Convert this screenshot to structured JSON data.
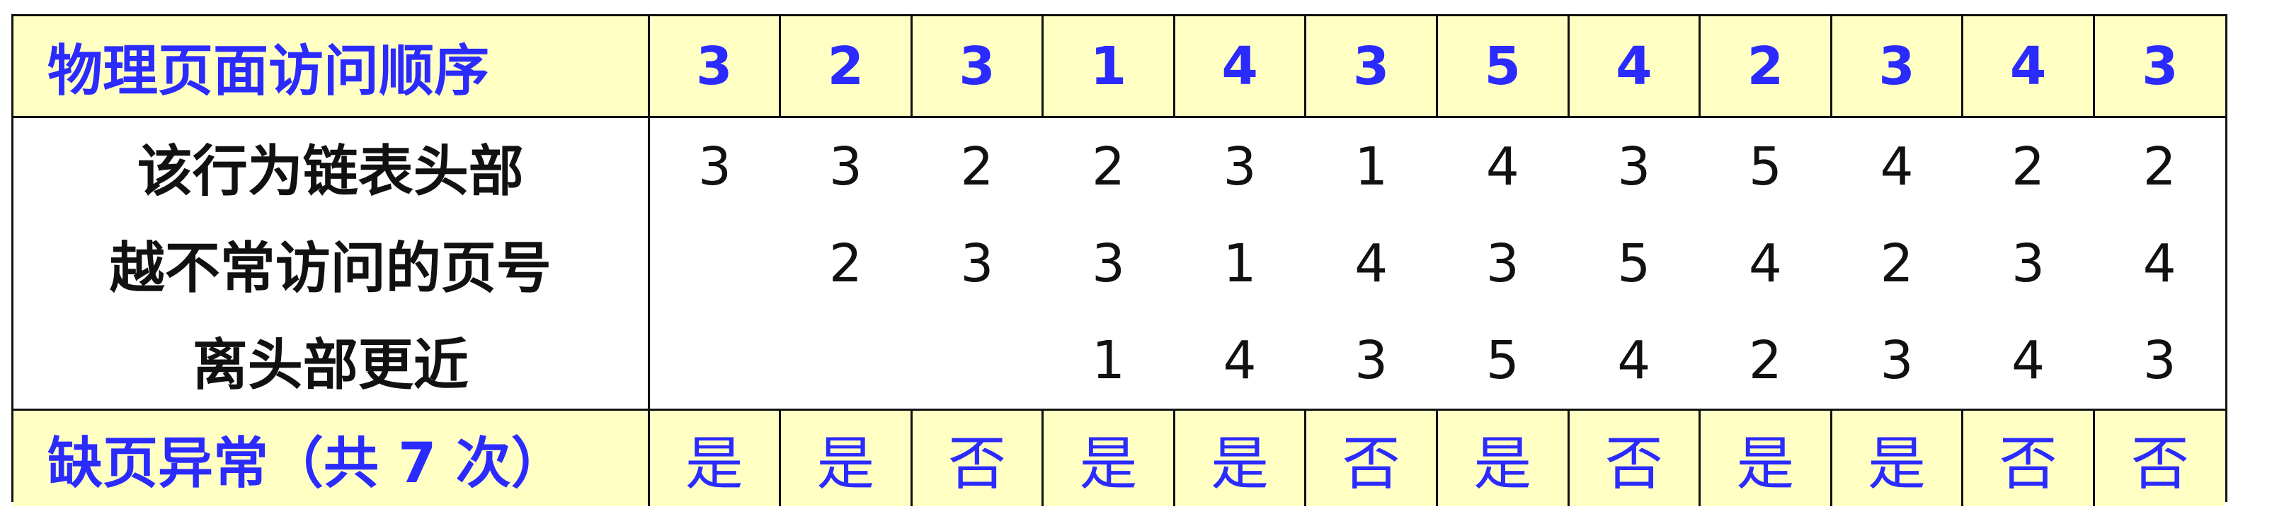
{
  "header": {
    "label": "物理页面访问顺序",
    "sequence": [
      "3",
      "2",
      "3",
      "1",
      "4",
      "3",
      "5",
      "4",
      "2",
      "3",
      "4",
      "3"
    ]
  },
  "rows": [
    {
      "label": "该行为链表头部",
      "cells": [
        "3",
        "3",
        "2",
        "2",
        "3",
        "1",
        "4",
        "3",
        "5",
        "4",
        "2",
        "2"
      ]
    },
    {
      "label": "越不常访问的页号",
      "cells": [
        "",
        "2",
        "3",
        "3",
        "1",
        "4",
        "3",
        "5",
        "4",
        "2",
        "3",
        "4"
      ]
    },
    {
      "label": "离头部更近",
      "cells": [
        "",
        "",
        "",
        "1",
        "4",
        "3",
        "5",
        "4",
        "2",
        "3",
        "4",
        "3"
      ]
    }
  ],
  "footer": {
    "label": "缺页异常（共 7 次）",
    "faults": [
      "是",
      "是",
      "否",
      "是",
      "是",
      "否",
      "是",
      "否",
      "是",
      "是",
      "否",
      "否"
    ]
  }
}
